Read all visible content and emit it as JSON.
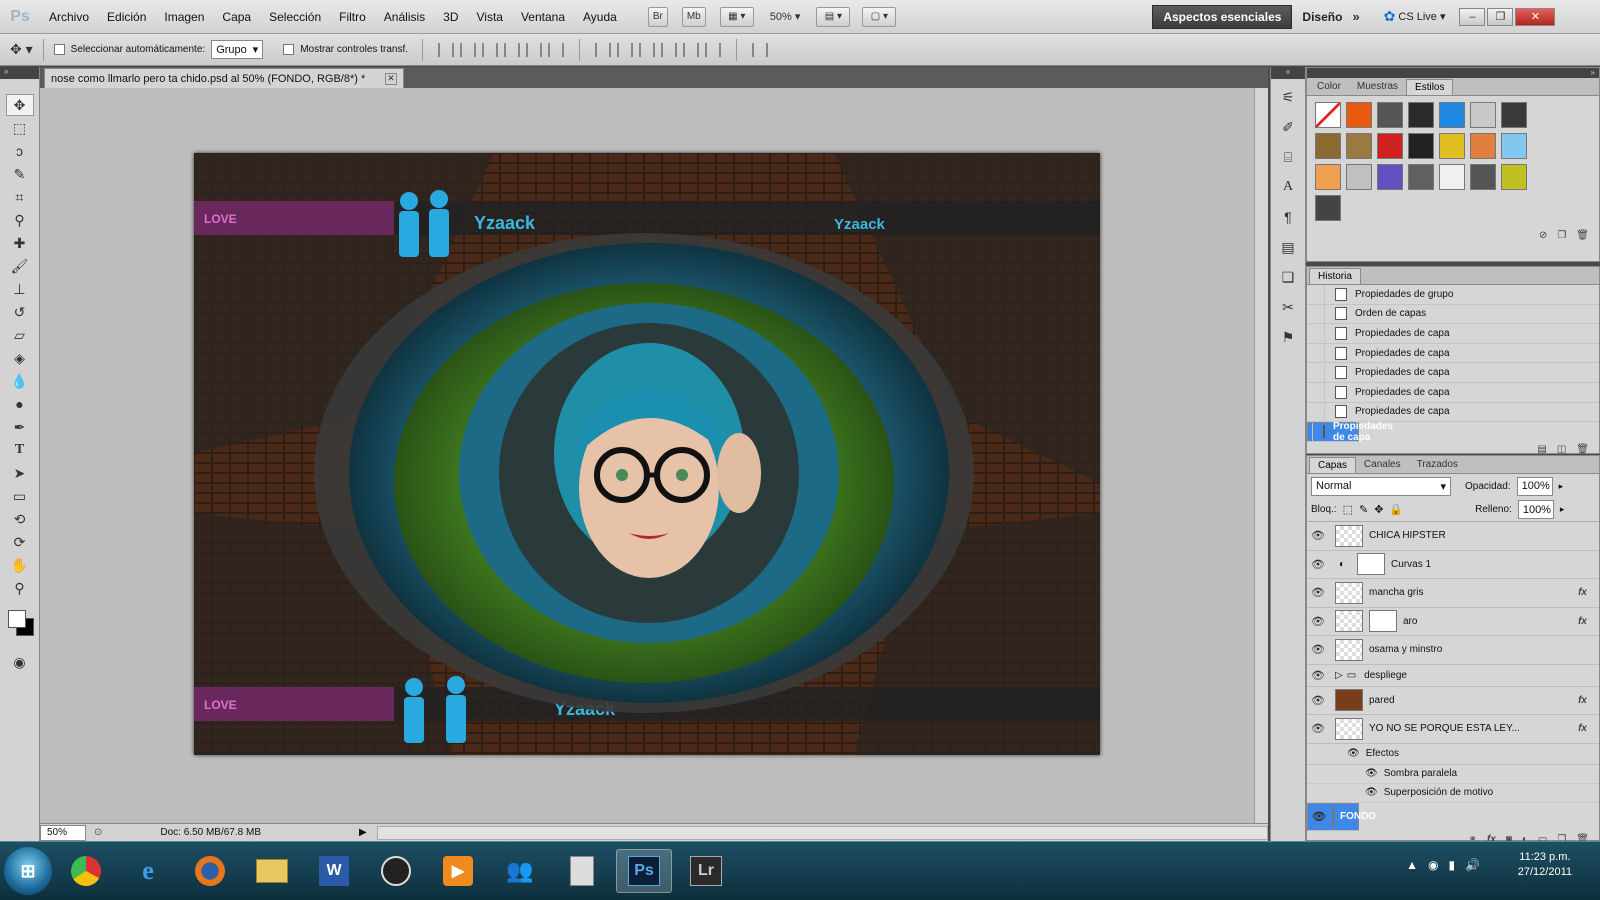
{
  "menubar": {
    "logo": "Ps",
    "items": [
      "Archivo",
      "Edición",
      "Imagen",
      "Capa",
      "Selección",
      "Filtro",
      "Análisis",
      "3D",
      "Vista",
      "Ventana",
      "Ayuda"
    ],
    "bridge": "Br",
    "minibridge": "Mb",
    "zoom": "50%",
    "workspace_active": "Aspectos esenciales",
    "workspace_other": "Diseño",
    "cslive": "CS Live"
  },
  "options": {
    "autoselect_label": "Seleccionar automáticamente:",
    "autoselect_value": "Grupo",
    "transform_label": "Mostrar controles transf."
  },
  "document": {
    "tab_title": "nose como llmarlo pero ta chido.psd al 50% (FONDO, RGB/8*) *"
  },
  "status": {
    "zoom": "50%",
    "doc_info": "Doc: 6.50 MB/67.8 MB"
  },
  "styles_panel": {
    "tabs": [
      "Color",
      "Muestras",
      "Estilos"
    ],
    "swatches": [
      "#f5f5f5",
      "#e85a10",
      "#555555",
      "#2a2a2a",
      "#1e88e0",
      "#c8c8c8",
      "#3a3a3a",
      "#8a6a30",
      "#9a7a40",
      "#d02020",
      "#222222",
      "#e0c020",
      "#e08040",
      "#80c8f0",
      "#f0a050",
      "#c0c0c0",
      "#6050c0",
      "#606060",
      "#f0f0f0",
      "#555555",
      "#c0c020",
      "#444444"
    ]
  },
  "history_panel": {
    "title": "Historia",
    "items": [
      "Propiedades de grupo",
      "Orden de capas",
      "Propiedades de capa",
      "Propiedades de capa",
      "Propiedades de capa",
      "Propiedades de capa",
      "Propiedades de capa",
      "Propiedades de capa"
    ]
  },
  "layers_panel": {
    "tabs": [
      "Capas",
      "Canales",
      "Trazados"
    ],
    "blend_mode": "Normal",
    "opacity_label": "Opacidad:",
    "opacity": "100%",
    "lock_label": "Bloq.:",
    "fill_label": "Relleno:",
    "fill": "100%",
    "layers": [
      {
        "name": "CHICA HIPSTER",
        "fx": ""
      },
      {
        "name": "Curvas 1",
        "fx": ""
      },
      {
        "name": "mancha gris",
        "fx": "fx"
      },
      {
        "name": "aro",
        "fx": "fx"
      },
      {
        "name": "osama y minstro",
        "fx": ""
      },
      {
        "name": "despliege",
        "fx": ""
      },
      {
        "name": "pared",
        "fx": "fx"
      },
      {
        "name": "YO NO SE PORQUE ESTA LEY...",
        "fx": "fx"
      }
    ],
    "effects_label": "Efectos",
    "effects": [
      "Sombra paralela",
      "Superposición de motivo"
    ],
    "selected_layer": "FONDO"
  },
  "taskbar": {
    "ps_label": "Ps",
    "lr_label": "Lr",
    "time": "11:23 p.m.",
    "date": "27/12/2011"
  },
  "canvas_text": {
    "watermark": "Yzaack",
    "love": "LOVE"
  }
}
